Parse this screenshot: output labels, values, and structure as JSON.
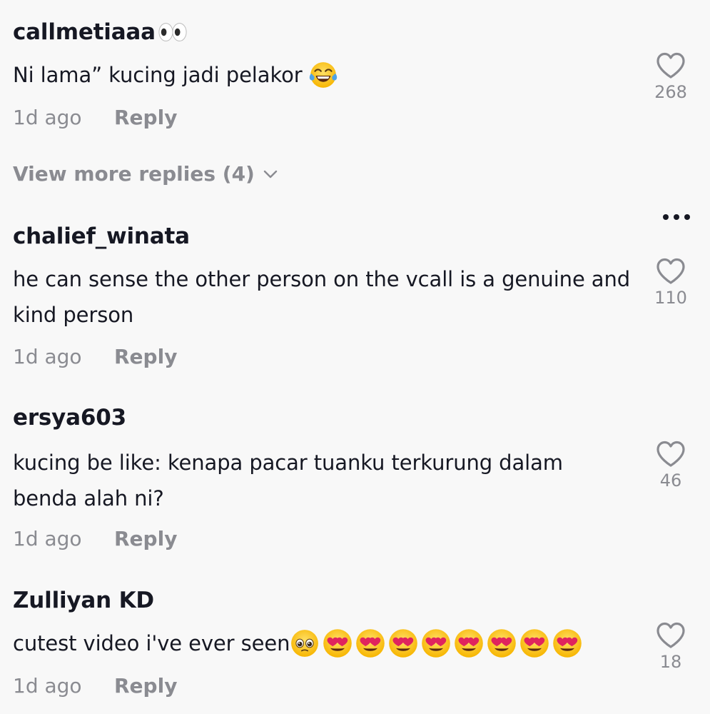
{
  "comments": [
    {
      "username": "callmetiaaa",
      "username_emoji": "eyes-emoji",
      "text": "Ni lama” kucing jadi pelakor",
      "text_emojis": [
        "tears-of-joy-emoji"
      ],
      "time": "1d ago",
      "reply": "Reply",
      "likes": "268"
    },
    {
      "username": "chalief_winata",
      "text": "he can sense the other person on the vcall is a genuine and kind person",
      "time": "1d ago",
      "reply": "Reply",
      "likes": "110"
    },
    {
      "username": "ersya603",
      "text": "kucing be like: kenapa pacar tuanku terkurung dalam benda alah ni?",
      "time": "1d ago",
      "reply": "Reply",
      "likes": "46"
    },
    {
      "username": "Zulliyan KD",
      "text": "cutest video i've ever seen",
      "text_emojis": [
        "pleading-face-emoji",
        "heart-eyes-emoji",
        "heart-eyes-emoji",
        "heart-eyes-emoji",
        "heart-eyes-emoji",
        "heart-eyes-emoji",
        "heart-eyes-emoji",
        "heart-eyes-emoji",
        "heart-eyes-emoji"
      ],
      "time": "1d ago",
      "reply": "Reply",
      "likes": "18"
    }
  ],
  "view_more": {
    "label": "View more replies (4)"
  },
  "icons": {
    "like": "heart-outline-icon",
    "more": "more-horizontal-icon",
    "expand": "chevron-down-icon"
  }
}
